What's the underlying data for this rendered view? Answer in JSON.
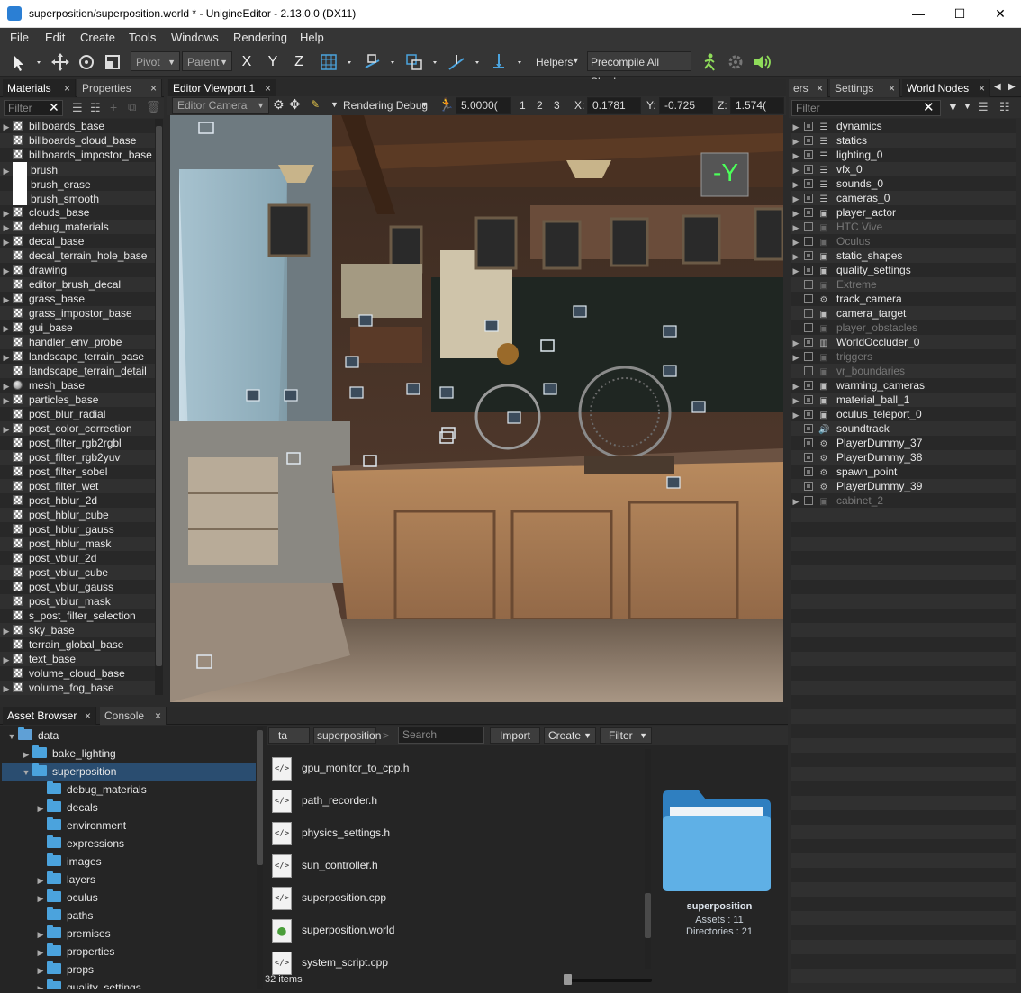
{
  "window": {
    "title": "superposition/superposition.world * - UnigineEditor - 2.13.0.0 (DX11)",
    "min": "—",
    "max": "☐",
    "close": "✕"
  },
  "menu": [
    "File",
    "Edit",
    "Create",
    "Tools",
    "Windows",
    "Rendering",
    "Help"
  ],
  "toolbar": {
    "pivot": "Pivot",
    "parent": "Parent",
    "x": "X",
    "y": "Y",
    "z": "Z",
    "helpers": "Helpers",
    "precompile": "Precompile All Shaders"
  },
  "materials_panel": {
    "tabs": [
      "Materials",
      "Properties"
    ],
    "filter_placeholder": "Filter",
    "items": [
      {
        "label": "billboards_base",
        "arrow": true,
        "icon": "checker"
      },
      {
        "label": "billboards_cloud_base",
        "arrow": false,
        "icon": "checker"
      },
      {
        "label": "billboards_impostor_base",
        "arrow": false,
        "icon": "checker"
      },
      {
        "label": "brush",
        "arrow": true,
        "icon": "white"
      },
      {
        "label": "brush_erase",
        "arrow": false,
        "icon": "white"
      },
      {
        "label": "brush_smooth",
        "arrow": false,
        "icon": "white"
      },
      {
        "label": "clouds_base",
        "arrow": true,
        "icon": "checker"
      },
      {
        "label": "debug_materials",
        "arrow": true,
        "icon": "checker"
      },
      {
        "label": "decal_base",
        "arrow": true,
        "icon": "checker"
      },
      {
        "label": "decal_terrain_hole_base",
        "arrow": false,
        "icon": "checker"
      },
      {
        "label": "drawing",
        "arrow": true,
        "icon": "checker"
      },
      {
        "label": "editor_brush_decal",
        "arrow": false,
        "icon": "checker"
      },
      {
        "label": "grass_base",
        "arrow": true,
        "icon": "checker"
      },
      {
        "label": "grass_impostor_base",
        "arrow": false,
        "icon": "checker"
      },
      {
        "label": "gui_base",
        "arrow": true,
        "icon": "checker"
      },
      {
        "label": "handler_env_probe",
        "arrow": false,
        "icon": "checker"
      },
      {
        "label": "landscape_terrain_base",
        "arrow": true,
        "icon": "checker"
      },
      {
        "label": "landscape_terrain_detail",
        "arrow": false,
        "icon": "checker"
      },
      {
        "label": "mesh_base",
        "arrow": true,
        "icon": "sphere"
      },
      {
        "label": "particles_base",
        "arrow": true,
        "icon": "checker"
      },
      {
        "label": "post_blur_radial",
        "arrow": false,
        "icon": "checker"
      },
      {
        "label": "post_color_correction",
        "arrow": true,
        "icon": "checker"
      },
      {
        "label": "post_filter_rgb2rgbl",
        "arrow": false,
        "icon": "checker"
      },
      {
        "label": "post_filter_rgb2yuv",
        "arrow": false,
        "icon": "checker"
      },
      {
        "label": "post_filter_sobel",
        "arrow": false,
        "icon": "checker"
      },
      {
        "label": "post_filter_wet",
        "arrow": false,
        "icon": "checker"
      },
      {
        "label": "post_hblur_2d",
        "arrow": false,
        "icon": "checker"
      },
      {
        "label": "post_hblur_cube",
        "arrow": false,
        "icon": "checker"
      },
      {
        "label": "post_hblur_gauss",
        "arrow": false,
        "icon": "checker"
      },
      {
        "label": "post_hblur_mask",
        "arrow": false,
        "icon": "checker"
      },
      {
        "label": "post_vblur_2d",
        "arrow": false,
        "icon": "checker"
      },
      {
        "label": "post_vblur_cube",
        "arrow": false,
        "icon": "checker"
      },
      {
        "label": "post_vblur_gauss",
        "arrow": false,
        "icon": "checker"
      },
      {
        "label": "post_vblur_mask",
        "arrow": false,
        "icon": "checker"
      },
      {
        "label": "s_post_filter_selection",
        "arrow": false,
        "icon": "checker"
      },
      {
        "label": "sky_base",
        "arrow": true,
        "icon": "checker"
      },
      {
        "label": "terrain_global_base",
        "arrow": false,
        "icon": "checker"
      },
      {
        "label": "text_base",
        "arrow": true,
        "icon": "checker"
      },
      {
        "label": "volume_cloud_base",
        "arrow": false,
        "icon": "checker"
      },
      {
        "label": "volume_fog_base",
        "arrow": true,
        "icon": "checker"
      }
    ]
  },
  "viewport": {
    "tab": "Editor Viewport 1",
    "camera": "Editor Camera",
    "render_debug": "Rendering Debug",
    "speed": "5.0000(",
    "presets": [
      "1",
      "2",
      "3"
    ],
    "x_label": "X:",
    "x_value": "0.1781",
    "y_label": "Y:",
    "y_value": "-0.725",
    "z_label": "Z:",
    "z_value": "1.574(",
    "axis_gizmo": "-Y"
  },
  "world_panel": {
    "tabs": [
      "ers",
      "Settings",
      "World Nodes"
    ],
    "filter_placeholder": "Filter",
    "nodes": [
      {
        "label": "dynamics",
        "arrow": true,
        "icon": "layers",
        "dim": false,
        "checked": true
      },
      {
        "label": "statics",
        "arrow": true,
        "icon": "layers",
        "dim": false,
        "checked": true
      },
      {
        "label": "lighting_0",
        "arrow": true,
        "icon": "layers",
        "dim": false,
        "checked": true
      },
      {
        "label": "vfx_0",
        "arrow": true,
        "icon": "layers",
        "dim": false,
        "checked": true
      },
      {
        "label": "sounds_0",
        "arrow": true,
        "icon": "layers",
        "dim": false,
        "checked": true
      },
      {
        "label": "cameras_0",
        "arrow": true,
        "icon": "layers",
        "dim": false,
        "checked": true
      },
      {
        "label": "player_actor",
        "arrow": true,
        "icon": "node",
        "dim": false,
        "checked": true
      },
      {
        "label": "HTC Vive",
        "arrow": true,
        "icon": "node",
        "dim": true,
        "checked": false
      },
      {
        "label": "Oculus",
        "arrow": true,
        "icon": "node",
        "dim": true,
        "checked": false
      },
      {
        "label": "static_shapes",
        "arrow": true,
        "icon": "node",
        "dim": false,
        "checked": true
      },
      {
        "label": "quality_settings",
        "arrow": true,
        "icon": "node",
        "dim": false,
        "checked": true
      },
      {
        "label": "Extreme",
        "arrow": false,
        "icon": "node",
        "dim": true,
        "checked": false
      },
      {
        "label": "track_camera",
        "arrow": false,
        "icon": "camera",
        "dim": false,
        "checked": false
      },
      {
        "label": "camera_target",
        "arrow": false,
        "icon": "node",
        "dim": false,
        "checked": false
      },
      {
        "label": "player_obstacles",
        "arrow": false,
        "icon": "node",
        "dim": true,
        "checked": false
      },
      {
        "label": "WorldOccluder_0",
        "arrow": true,
        "icon": "grid",
        "dim": false,
        "checked": true
      },
      {
        "label": "triggers",
        "arrow": true,
        "icon": "node",
        "dim": true,
        "checked": false
      },
      {
        "label": "vr_boundaries",
        "arrow": false,
        "icon": "node",
        "dim": true,
        "checked": false
      },
      {
        "label": "warming_cameras",
        "arrow": true,
        "icon": "node",
        "dim": false,
        "checked": true
      },
      {
        "label": "material_ball_1",
        "arrow": true,
        "icon": "node",
        "dim": false,
        "checked": true
      },
      {
        "label": "oculus_teleport_0",
        "arrow": true,
        "icon": "node",
        "dim": false,
        "checked": true
      },
      {
        "label": "soundtrack",
        "arrow": false,
        "icon": "sound",
        "dim": false,
        "checked": true
      },
      {
        "label": "PlayerDummy_37",
        "arrow": false,
        "icon": "camera",
        "dim": false,
        "checked": true
      },
      {
        "label": "PlayerDummy_38",
        "arrow": false,
        "icon": "camera",
        "dim": false,
        "checked": true
      },
      {
        "label": "spawn_point",
        "arrow": false,
        "icon": "camera",
        "dim": false,
        "checked": true
      },
      {
        "label": "PlayerDummy_39",
        "arrow": false,
        "icon": "camera",
        "dim": false,
        "checked": true
      },
      {
        "label": "cabinet_2",
        "arrow": true,
        "icon": "node",
        "dim": true,
        "checked": false
      }
    ]
  },
  "bottom_tabs": [
    "Asset Browser",
    "Console"
  ],
  "asset_tree": [
    {
      "label": "data",
      "depth": 0,
      "arrow": "down",
      "selected": false,
      "root": true
    },
    {
      "label": "bake_lighting",
      "depth": 1,
      "arrow": "right",
      "selected": false
    },
    {
      "label": "superposition",
      "depth": 1,
      "arrow": "down",
      "selected": true
    },
    {
      "label": "debug_materials",
      "depth": 2,
      "arrow": "",
      "selected": false
    },
    {
      "label": "decals",
      "depth": 2,
      "arrow": "right",
      "selected": false
    },
    {
      "label": "environment",
      "depth": 2,
      "arrow": "",
      "selected": false
    },
    {
      "label": "expressions",
      "depth": 2,
      "arrow": "",
      "selected": false
    },
    {
      "label": "images",
      "depth": 2,
      "arrow": "",
      "selected": false
    },
    {
      "label": "layers",
      "depth": 2,
      "arrow": "right",
      "selected": false
    },
    {
      "label": "oculus",
      "depth": 2,
      "arrow": "right",
      "selected": false
    },
    {
      "label": "paths",
      "depth": 2,
      "arrow": "",
      "selected": false
    },
    {
      "label": "premises",
      "depth": 2,
      "arrow": "right",
      "selected": false
    },
    {
      "label": "properties",
      "depth": 2,
      "arrow": "right",
      "selected": false
    },
    {
      "label": "props",
      "depth": 2,
      "arrow": "right",
      "selected": false
    },
    {
      "label": "quality_settings",
      "depth": 2,
      "arrow": "right",
      "selected": false
    }
  ],
  "asset_browser": {
    "crumbs": [
      "ta",
      "superposition"
    ],
    "crumb_sep": ">",
    "search_placeholder": "Search",
    "import": "Import",
    "create": "Create",
    "filter": "Filter",
    "files": [
      {
        "name": "gpu_monitor_to_cpp.h",
        "icon": "code"
      },
      {
        "name": "path_recorder.h",
        "icon": "code"
      },
      {
        "name": "physics_settings.h",
        "icon": "code"
      },
      {
        "name": "sun_controller.h",
        "icon": "code"
      },
      {
        "name": "superposition.cpp",
        "icon": "code"
      },
      {
        "name": "superposition.world",
        "icon": "world"
      },
      {
        "name": "system_script.cpp",
        "icon": "code"
      }
    ],
    "count": "32 items",
    "preview": {
      "name": "superposition",
      "assets": "Assets : 11",
      "dirs": "Directories : 21"
    }
  },
  "colors": {
    "accent": "#2e6da4",
    "folder": "#4ba3dd",
    "selection": "#2a4d70"
  }
}
